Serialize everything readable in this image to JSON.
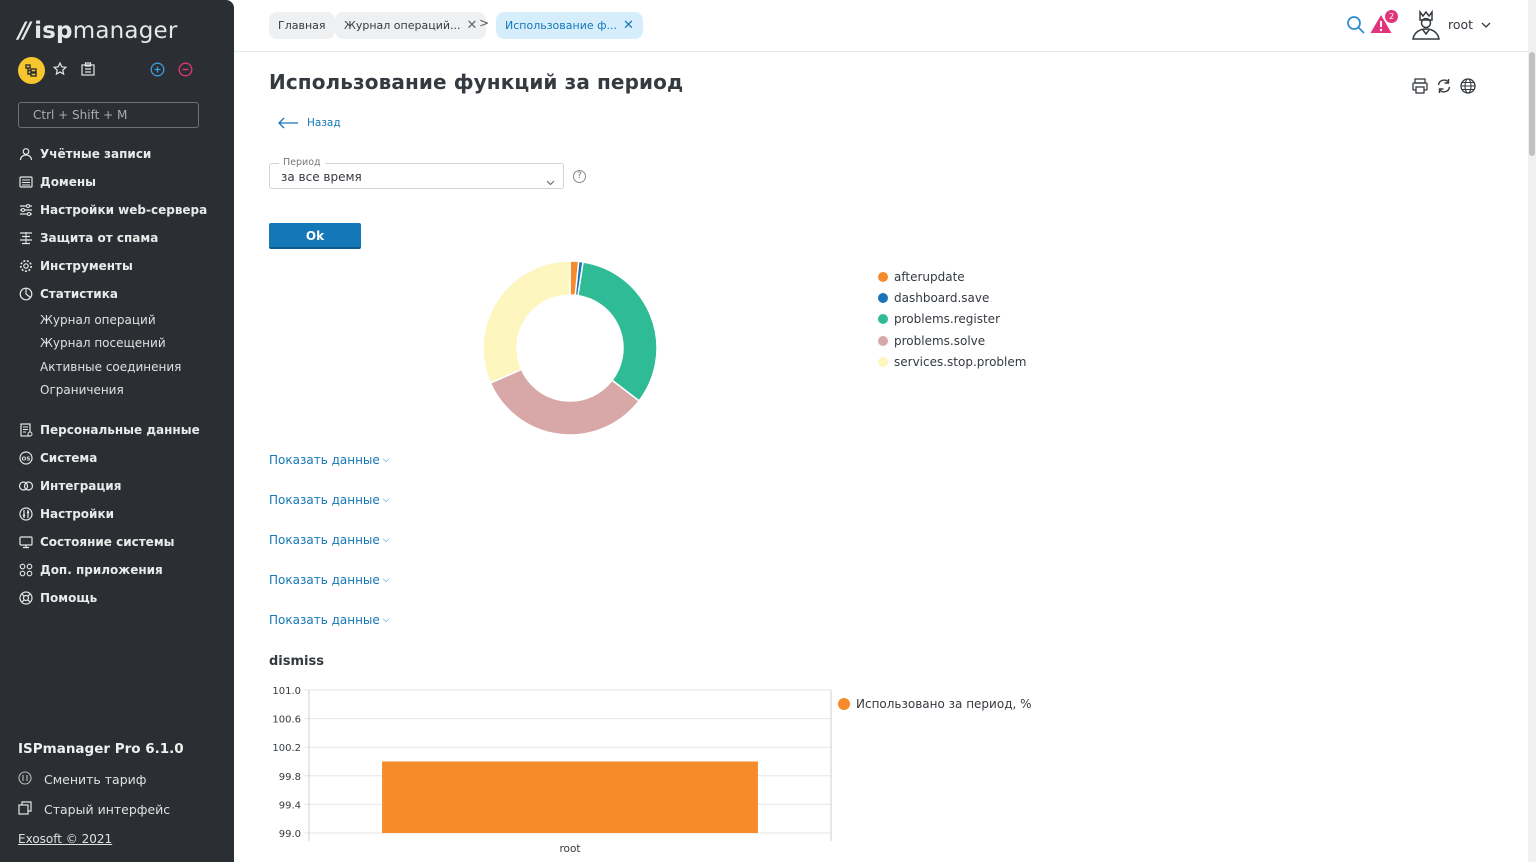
{
  "sidebar": {
    "logo_mark": "//",
    "logo_text_bold": "isp",
    "logo_text": "manager",
    "command_placeholder": "Ctrl + Shift + M",
    "nav": [
      {
        "label": "Учётные записи",
        "icon": "users-icon"
      },
      {
        "label": "Домены",
        "icon": "domains-icon"
      },
      {
        "label": "Настройки web-сервера",
        "icon": "sliders-icon"
      },
      {
        "label": "Защита от спама",
        "icon": "spam-filter-icon"
      },
      {
        "label": "Инструменты",
        "icon": "gear-icon"
      },
      {
        "label": "Статистика",
        "icon": "pie-chart-icon"
      }
    ],
    "sub_items": [
      "Журнал операций",
      "Журнал посещений",
      "Активные соединения",
      "Ограничения"
    ],
    "nav2": [
      {
        "label": "Персональные данные",
        "icon": "personal-data-icon"
      },
      {
        "label": "Система",
        "icon": "os-icon"
      },
      {
        "label": "Интеграция",
        "icon": "integration-icon"
      },
      {
        "label": "Настройки",
        "icon": "settings-icon"
      },
      {
        "label": "Состояние системы",
        "icon": "monitor-icon"
      },
      {
        "label": "Доп. приложения",
        "icon": "apps-icon"
      },
      {
        "label": "Помощь",
        "icon": "help-lifebuoy-icon"
      }
    ],
    "product": "ISPmanager Pro 6.1.0",
    "change_tariff": "Сменить тариф",
    "old_interface": "Старый интерфейс",
    "copyright": "Exosoft © 2021"
  },
  "topbar": {
    "breadcrumbs": [
      {
        "label": "Главная"
      },
      {
        "label": "Журнал операций..."
      },
      {
        "label": "Использование ф..."
      }
    ],
    "separator": ">",
    "notifications_count": "2",
    "user": "root"
  },
  "main": {
    "title": "Использование функций за период",
    "back_label": "Назад",
    "period_label": "Период",
    "period_value": "за все время",
    "help_label": "?",
    "ok_label": "Ok",
    "show_data_label": "Показать данные",
    "bar_chart_title": "dismiss"
  },
  "colors": {
    "accent": "#1478b8",
    "orange": "#f58b2a",
    "blue": "#1a73b8",
    "green": "#30bb97",
    "pink": "#d8a7a7",
    "yellow": "#fdf6bf"
  },
  "chart_data": [
    {
      "type": "pie",
      "donut": true,
      "legend_position": "right",
      "series": [
        {
          "name": "afterupdate",
          "value": 1.6,
          "color": "#f58b2a"
        },
        {
          "name": "dashboard.save",
          "value": 0.8,
          "color": "#1a73b8"
        },
        {
          "name": "problems.register",
          "value": 33.0,
          "color": "#30bb97"
        },
        {
          "name": "problems.solve",
          "value": 33.0,
          "color": "#d8a7a7"
        },
        {
          "name": "services.stop.problem",
          "value": 31.6,
          "color": "#fdf6bf"
        }
      ]
    },
    {
      "type": "bar",
      "title": "dismiss",
      "categories": [
        "root"
      ],
      "series": [
        {
          "name": "Использовано за период, %",
          "values": [
            100
          ],
          "color": "#f58b2a"
        }
      ],
      "ylim": [
        99.0,
        101.0
      ],
      "yticks": [
        "101.0",
        "100.6",
        "100.2",
        "99.8",
        "99.4",
        "99.0"
      ],
      "legend_position": "right",
      "grid": true
    }
  ]
}
